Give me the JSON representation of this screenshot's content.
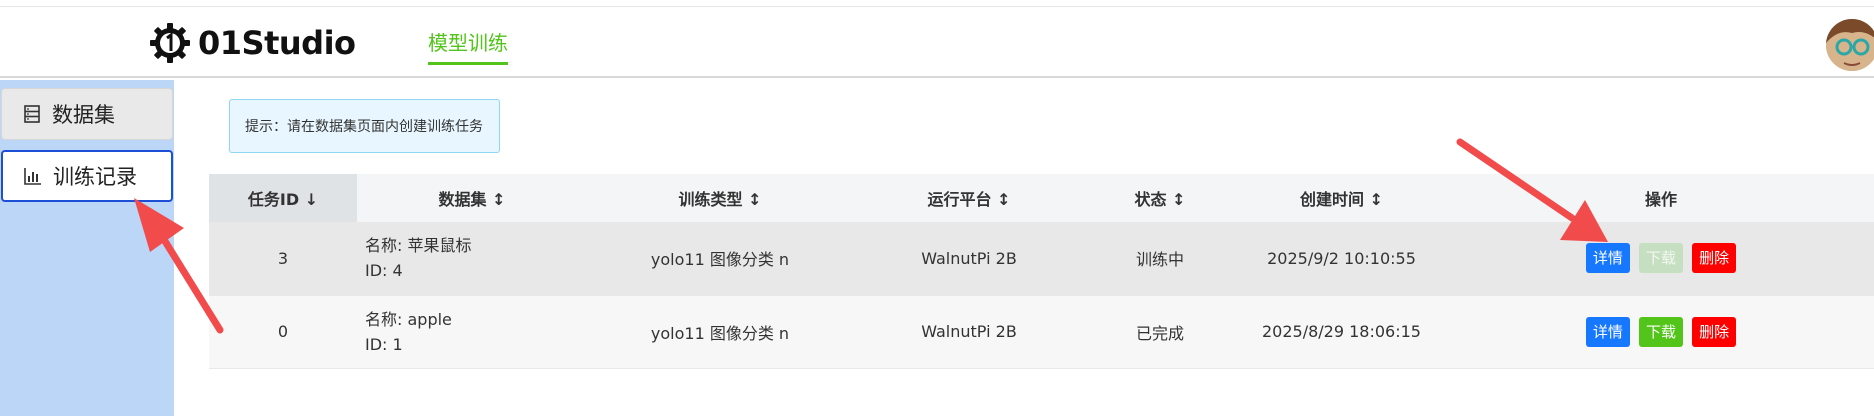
{
  "header": {
    "logo_text": "01Studio",
    "nav_tab": "模型训练"
  },
  "sidebar": {
    "items": [
      {
        "label": "数据集",
        "icon": "database-icon"
      },
      {
        "label": "训练记录",
        "icon": "bar-chart-icon"
      }
    ]
  },
  "hint": "提示：请在数据集页面内创建训练任务",
  "table": {
    "headers": [
      "任务ID ↓",
      "数据集 ↕",
      "训练类型 ↕",
      "运行平台 ↕",
      "状态 ↕",
      "创建时间 ↕",
      "操作"
    ],
    "rows": [
      {
        "id": "3",
        "dataset_name": "名称: 苹果鼠标",
        "dataset_id": "ID: 4",
        "type": "yolo11 图像分类 n",
        "platform": "WalnutPi 2B",
        "status": "训练中",
        "created": "2025/9/2 10:10:55",
        "actions": [
          "详情",
          "下载",
          "删除"
        ]
      },
      {
        "id": "0",
        "dataset_name": "名称: apple",
        "dataset_id": "ID: 1",
        "type": "yolo11 图像分类 n",
        "platform": "WalnutPi 2B",
        "status": "已完成",
        "created": "2025/8/29 18:06:15",
        "actions": [
          "详情",
          "下载",
          "删除"
        ]
      }
    ]
  },
  "colors": {
    "accent_green": "#52c41a",
    "sidebar_bg": "#bcd6f7",
    "primary_blue": "#1677ff",
    "danger_red": "#ff0000",
    "running_orange": "#f5a623",
    "annotation_arrow": "#f24b4b"
  }
}
